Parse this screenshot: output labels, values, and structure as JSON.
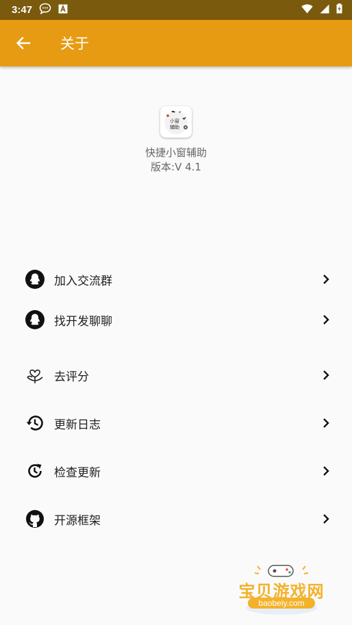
{
  "status_bar": {
    "time": "3:47",
    "icons": [
      "chat-bubble-icon",
      "a-badge-icon",
      "wifi-icon",
      "signal-icon",
      "battery-charging-icon"
    ]
  },
  "app_bar": {
    "title": "关于",
    "back_icon": "arrow-left-icon"
  },
  "app_info": {
    "icon_text": [
      "小窗",
      "辅助"
    ],
    "name": "快捷小窗辅助",
    "version": "版本:V 4.1"
  },
  "menu": {
    "items": [
      {
        "label": "加入交流群",
        "icon": "qq-penguin-icon"
      },
      {
        "label": "找开发聊聊",
        "icon": "qq-penguin-icon"
      },
      {
        "label": "去评分",
        "icon": "flower-heart-icon"
      },
      {
        "label": "更新日志",
        "icon": "history-icon"
      },
      {
        "label": "检查更新",
        "icon": "clock-refresh-icon"
      },
      {
        "label": "开源框架",
        "icon": "github-icon"
      }
    ]
  },
  "watermark": {
    "text": "宝贝游戏网",
    "domain": "baobeiy.com"
  },
  "colors": {
    "status_bar": "#7a5a0d",
    "app_bar": "#e69b12",
    "background": "#fafafa",
    "watermark": "#f3b22a"
  }
}
